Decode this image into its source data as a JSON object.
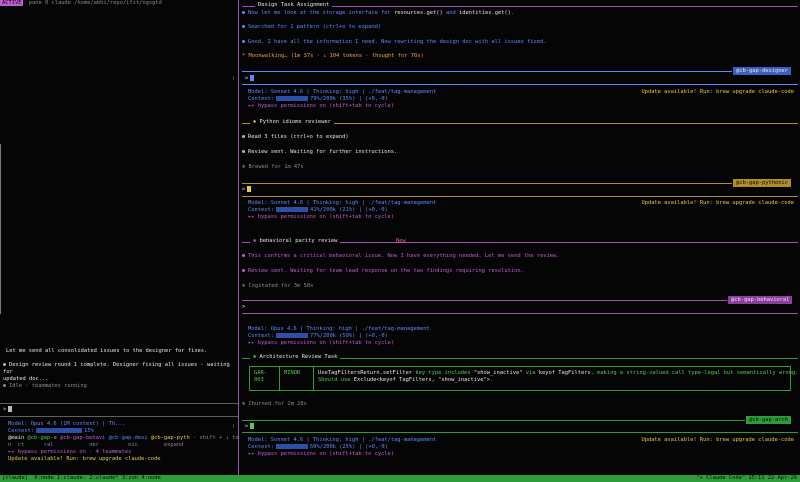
{
  "left_pane": {
    "header_badge": "ACTIVE",
    "header_text": "pane 0  claude  /home/abhi/repo/ifit/ogsgtd",
    "message": "Let me send all consolidated issues to the designer for fixes.",
    "review_line1": "Design review round 1 complete. Designer fixing all issues - waiting for",
    "review_line2": "updated doc...",
    "idle_line": "Idle · teammates running",
    "prompt": ">",
    "model_line": "Model: Opus 4.6 (1M context) | Th...",
    "context_label": "Context:",
    "context_value": "15%",
    "agents_prefix": "@main",
    "agents": [
      "@cb-gap-a",
      "@cb-gap-behavi",
      "@cb-gap-desi",
      "@cb-gap-pyth"
    ],
    "agents_suffix": "· shift + ↓ to",
    "agents_row2": [
      "n",
      "ct",
      "ral",
      "ner",
      "nic",
      "expand"
    ],
    "bypass": "▸▸ bypass permissions on · 4 teammates",
    "update": "Update available! Run: brew upgrade claude-code"
  },
  "pane_designer": {
    "title": "Design Task Assignment",
    "line1_a": "Now let me look at the storage interface for",
    "line1_code1": "resources.get()",
    "line1_and": "and",
    "line1_code2": "identities.get()",
    "line1_end": ".",
    "line2": "Searched for 1 pattern (ctrl+o to expand)",
    "line3": "Good, I have all the information I need. Now rewriting the design doc with all issues fixed.",
    "line4": "Moonwalking… (1m 37s · ↓ 104 tokens · thought for 70s)",
    "tag": "@cb-gap-designer",
    "prompt": ">",
    "model_line": "Model: Sonnet 4.6 | Thinking: high | ./feat/tag-management",
    "update": "Update available! Run: brew upgrade claude-code",
    "context_label": "Context:",
    "context_value": "79%/200k (35%) | (+0,-0)",
    "bypass": "▸▸ bypass permissions on (shift+tab to cycle)"
  },
  "pane_pythonic": {
    "section": "Python idioms reviewer",
    "line1": "Read 3 files (ctrl+o to expand)",
    "line2": "Review sent. Waiting for further instructions.",
    "line3": "Brewed for 1m 47s",
    "tag": "@cb-gap-pythonic",
    "prompt": ">",
    "model_line": "Model: Sonnet 4.6 | Thinking: high | ./feat/tag-management",
    "update": "Update available! Run: brew upgrade claude-code",
    "context_label": "Context:",
    "context_value": "41%/200k (21%) | (+0,-0)",
    "bypass": "▸▸ bypass permissions on (shift+tab to cycle)"
  },
  "pane_behavioral": {
    "section": "behavioral parity review",
    "badge": "New",
    "line1": "This confirms a critical behavioral issue. Now I have everything needed. Let me send the review.",
    "line2": "Review sent. Waiting for team lead response on the two findings requiring resolution.",
    "line3": "Cogitated for 3m 58s",
    "tag": "@cb-gap-behavioral",
    "prompt": ">",
    "model_line": "Model: Opus 4.6 | Thinking: high | ./feat/tag-management",
    "context_label": "Context:",
    "context_value": "77%/200k (59%) | (+0,-0)",
    "bypass": "▸▸ bypass permissions on (shift+tab to cycle)"
  },
  "pane_arch": {
    "section": "Architecture Review Task",
    "table": {
      "id": "GAR-003",
      "severity": "MINOR",
      "desc1_code": "UseTagFiltersReturn.setFilter",
      "desc1_a": "key type includes",
      "desc1_str": "\"show_inactive\"",
      "desc1_b": "via",
      "desc1_code2": "keyof TagFilters",
      "desc1_c": ", making a string-valued call type-legal but semantically wrong.",
      "desc2_a": "Should use",
      "desc2_code": "Exclude<keyof TagFilters, \"show_inactive\">",
      "desc2_end": "."
    },
    "line1": "Churned for 2m 28s",
    "tag": "@cb-gap-arch",
    "prompt": ">",
    "model_line": "Model: Sonnet 4.6 | Thinking: high | ./feat/tag-management",
    "update": "Update available! Run: brew upgrade claude-code",
    "context_label": "Context:",
    "context_value": "50%/200k (25%) | (+0,-0)",
    "bypass": "▸▸ bypass permissions on (shift+tab to cycle)"
  },
  "status_bar": {
    "session": "[claude]",
    "windows": "0:node  1:claude- 2:claude* 3:zsh  4:node",
    "right": "\"✳ Claude Code\" 15:11 22-Apr-26"
  },
  "colors": {
    "accent_purple": "#c25dd6",
    "status_green": "#2e9c3a",
    "context_bar": "#2e4fa8"
  }
}
